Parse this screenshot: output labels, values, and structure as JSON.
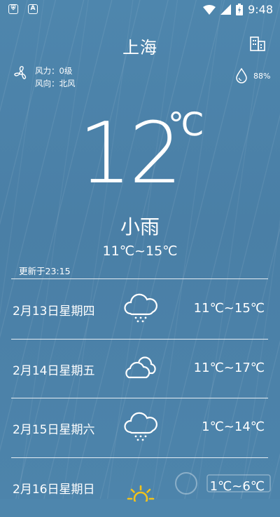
{
  "status_bar": {
    "time": "9:48"
  },
  "header": {
    "city": "上海"
  },
  "details": {
    "wind_power": "风力：0级",
    "wind_direction": "风向：北风",
    "humidity": "88%"
  },
  "current": {
    "temperature": "12",
    "unit": "℃",
    "condition": "小雨",
    "range": "11℃~15℃",
    "updated": "更新于23:15"
  },
  "forecast": [
    {
      "date": "2月13日星期四",
      "icon": "rain-cloud-icon",
      "range": "11℃~15℃"
    },
    {
      "date": "2月14日星期五",
      "icon": "cloudy-icon",
      "range": "11℃~17℃"
    },
    {
      "date": "2月15日星期六",
      "icon": "rain-cloud-icon",
      "range": "1℃~14℃"
    },
    {
      "date": "2月16日星期日",
      "icon": "sun-icon",
      "range": "1℃~6℃"
    }
  ],
  "colors": {
    "background": "#4a7fa6",
    "text": "#ffffff",
    "sun": "#f2c21b"
  }
}
